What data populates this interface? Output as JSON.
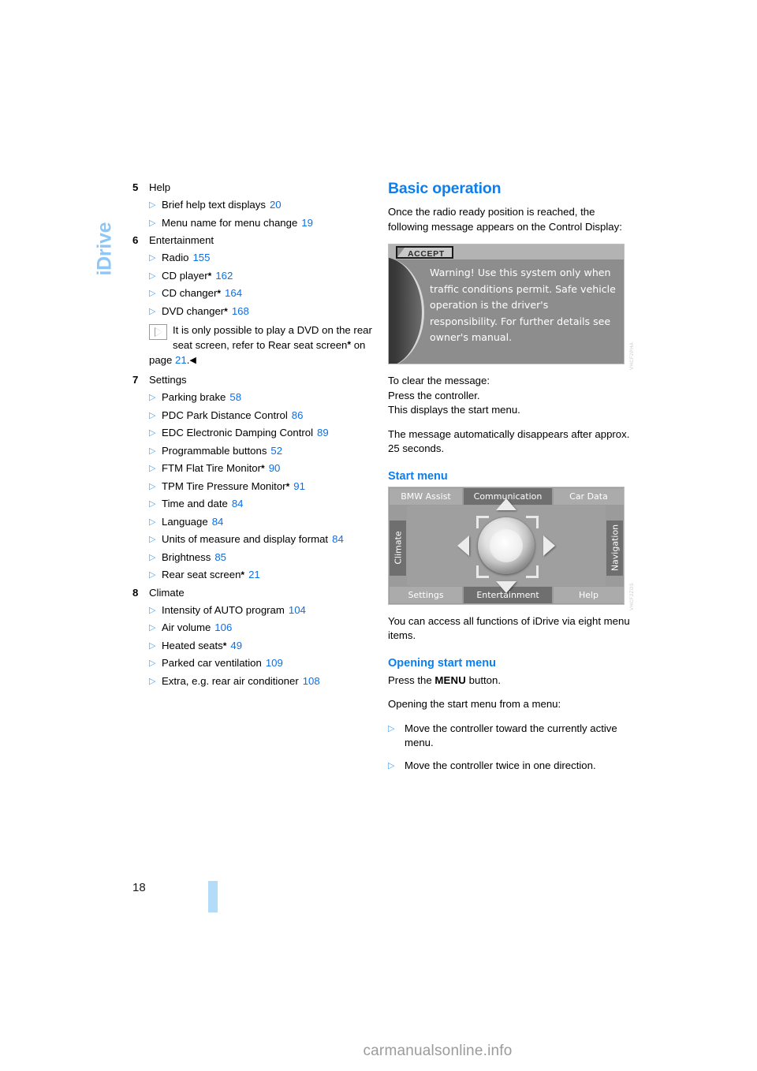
{
  "chapter": {
    "tab_label": "iDrive"
  },
  "page": {
    "number": "18",
    "watermark": "carmanualsonline.info"
  },
  "left_column": {
    "groups": [
      {
        "number": "5",
        "title": "Help",
        "items": [
          {
            "label": "Brief help text displays",
            "star": "",
            "page": "20"
          },
          {
            "label": "Menu name for menu change",
            "star": "",
            "page": "19"
          }
        ]
      },
      {
        "number": "6",
        "title": "Entertainment",
        "items": [
          {
            "label": "Radio",
            "star": "",
            "page": "155"
          },
          {
            "label": "CD player",
            "star": "*",
            "page": "162"
          },
          {
            "label": "CD changer",
            "star": "*",
            "page": "164"
          },
          {
            "label": "DVD changer",
            "star": "*",
            "page": "168"
          }
        ],
        "note": {
          "icon": "note-triangle-icon",
          "text_part1": "It is only possible to play a DVD on the rear seat screen, refer to Rear seat screen",
          "star": "*",
          "text_part2": " on page ",
          "page": "21",
          "end_marker": "◀"
        }
      },
      {
        "number": "7",
        "title": "Settings",
        "items": [
          {
            "label": "Parking brake",
            "star": "",
            "page": "58"
          },
          {
            "label": "PDC Park Distance Control",
            "star": "",
            "page": "86"
          },
          {
            "label": "EDC Electronic Damping Control",
            "star": "",
            "page": "89"
          },
          {
            "label": "Programmable buttons",
            "star": "",
            "page": "52"
          },
          {
            "label": "FTM Flat Tire Monitor",
            "star": "*",
            "page": "90"
          },
          {
            "label": "TPM Tire Pressure Monitor",
            "star": "*",
            "page": "91"
          },
          {
            "label": "Time and date",
            "star": "",
            "page": "84"
          },
          {
            "label": "Language",
            "star": "",
            "page": "84"
          },
          {
            "label": "Units of measure and display format",
            "star": "",
            "page": "84"
          },
          {
            "label": "Brightness",
            "star": "",
            "page": "85"
          },
          {
            "label": "Rear seat screen",
            "star": "*",
            "page": "21"
          }
        ]
      },
      {
        "number": "8",
        "title": "Climate",
        "items": [
          {
            "label": "Intensity of AUTO program",
            "star": "",
            "page": "104"
          },
          {
            "label": "Air volume",
            "star": "",
            "page": "106"
          },
          {
            "label": "Heated seats",
            "star": "*",
            "page": "49"
          },
          {
            "label": "Parked car ventilation",
            "star": "",
            "page": "109"
          },
          {
            "label": "Extra, e.g. rear air conditioner",
            "star": "",
            "page": "108"
          }
        ]
      }
    ]
  },
  "right_column": {
    "heading": "Basic operation",
    "intro": "Once the radio ready position is reached, the following message appears on the Control Display:",
    "warning_figure": {
      "accept_label": "ACCEPT",
      "message": "Warning! Use this system only when traffic conditions permit. Safe vehicle operation is the driver's responsibility. For further details see owner's manual.",
      "figure_code": "VHCF2PHA"
    },
    "clear_instructions": "To clear the message:\nPress the controller.\nThis displays the start menu.",
    "auto_dismiss": "The message automatically disappears after approx. 25 seconds.",
    "start_menu_heading": "Start menu",
    "start_menu_figure": {
      "top": [
        {
          "label": "BMW Assist",
          "state": "light"
        },
        {
          "label": "Communication",
          "state": "dark"
        },
        {
          "label": "Car Data",
          "state": "light"
        }
      ],
      "left": {
        "label": "Climate",
        "state": "dark"
      },
      "right": {
        "label": "Navigation",
        "state": "dark"
      },
      "bottom": [
        {
          "label": "Settings",
          "state": "light"
        },
        {
          "label": "Entertainment",
          "state": "dark"
        },
        {
          "label": "Help",
          "state": "light"
        }
      ],
      "figure_code": "VHCF2ZOS"
    },
    "access_text": "You can access all functions of iDrive via eight menu items.",
    "opening_heading": "Opening start menu",
    "press_prefix": "Press the ",
    "press_key": "MENU",
    "press_suffix": " button.",
    "opening_from_menu": "Opening the start menu from a menu:",
    "opening_items": [
      "Move the controller toward the currently active menu.",
      "Move the controller twice in one direction."
    ]
  },
  "colors": {
    "accent_blue": "#0b7ff0",
    "link_blue": "#0b6fe8",
    "triangle_blue": "#4aa3ef",
    "tab_blue": "#8ec6f5",
    "footer_tab": "#b3dcf8"
  }
}
